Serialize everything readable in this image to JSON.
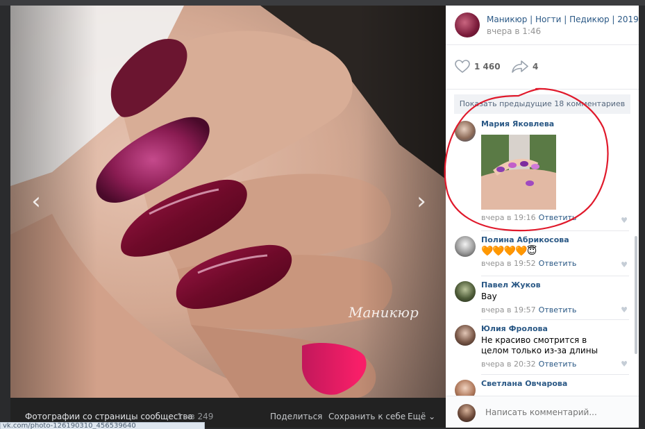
{
  "viewer": {
    "album_label": "Фотографии со страницы сообщества",
    "count_label": "1 из 249",
    "share_label": "Поделиться",
    "save_label": "Сохранить к себе",
    "more_label": "Ещё ⌄",
    "watermark": "Маникюр",
    "status_url": "vk.com/photo-126190310_456539640"
  },
  "post": {
    "group_name": "Маникюр | Ногти | Педикюр | 2019",
    "time": "вчера в 1:46",
    "likes": "1 460",
    "shares": "4"
  },
  "comments": {
    "show_previous": "Показать предыдущие 18 комментариев",
    "reply_label": "Ответить",
    "items": [
      {
        "author": "Мария Яковлева",
        "text": "",
        "time": "вчера в 19:16",
        "has_image": true
      },
      {
        "author": "Полина Абрикосова",
        "text": "🧡🧡🧡🧡😇",
        "time": "вчера в 19:52"
      },
      {
        "author": "Павел Жуков",
        "text": "Вау",
        "time": "вчера в 19:57"
      },
      {
        "author": "Юлия Фролова",
        "text": "Не красиво смотрится в целом только из-за длины",
        "time": "вчера в 20:32"
      },
      {
        "author": "Светлана Овчарова",
        "text": "",
        "time": ""
      }
    ]
  },
  "compose": {
    "placeholder": "Написать комментарий..."
  },
  "colors": {
    "link": "#2a5885",
    "nail_wine": "#7a0f2f",
    "annotation_red": "#e0192b"
  }
}
